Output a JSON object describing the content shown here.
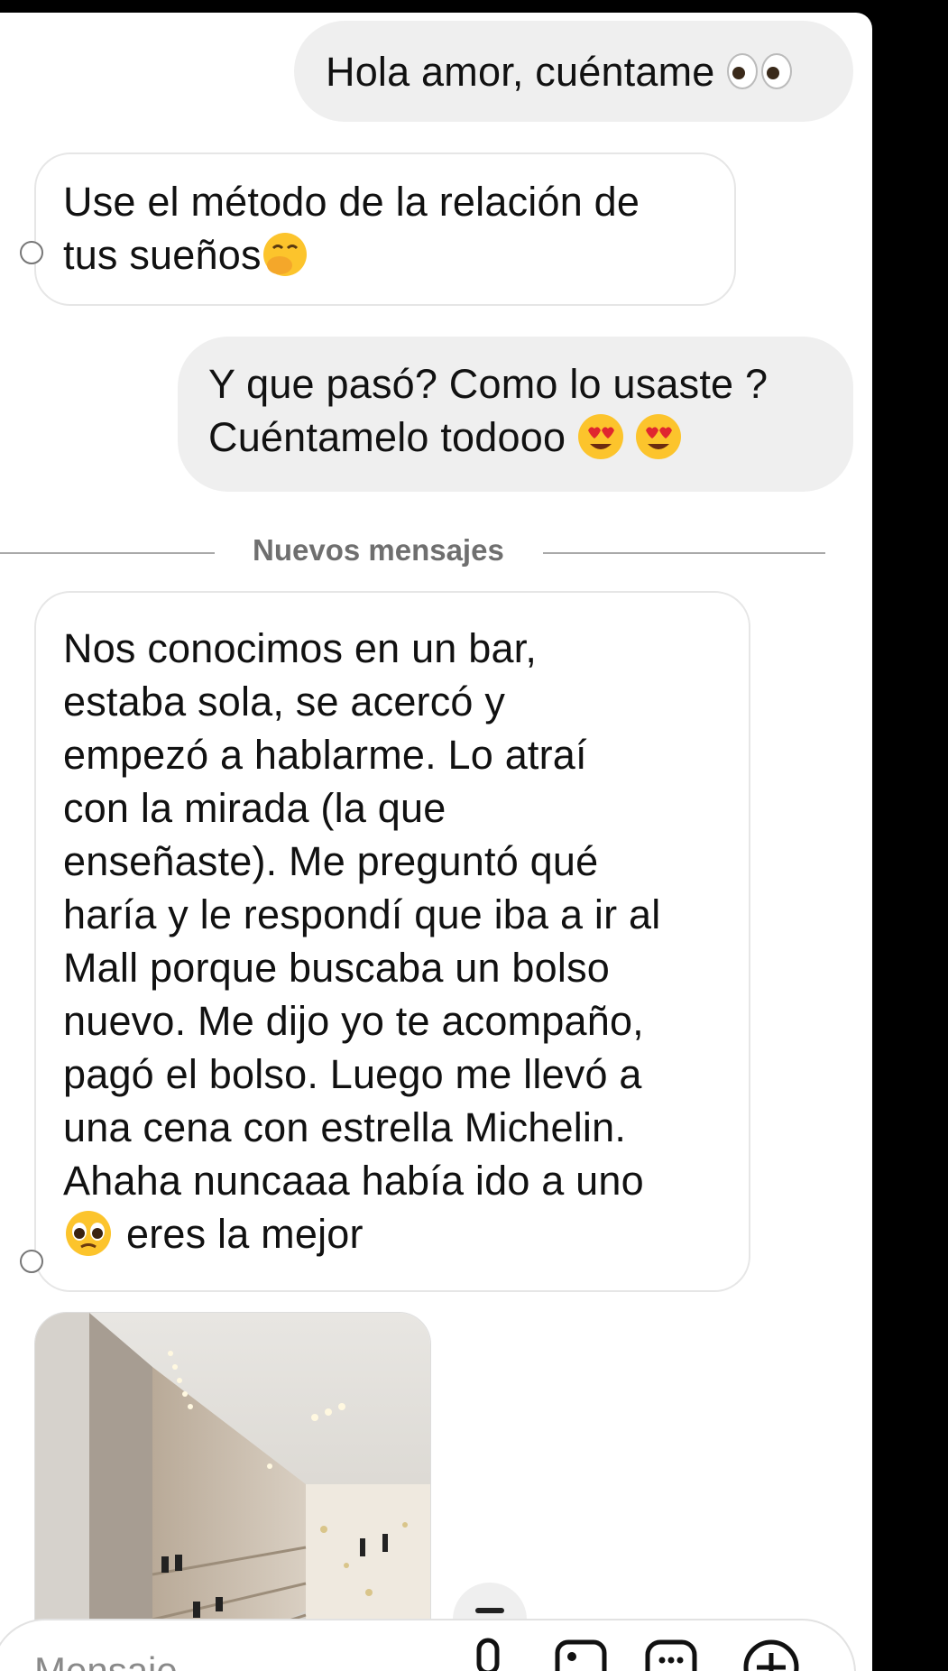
{
  "messages": [
    {
      "dir": "out",
      "text": "Hola amor, cuéntame",
      "emoji": "eyes-emoji"
    },
    {
      "dir": "in",
      "lines": [
        "Use el método de la relación de",
        "tus sueños"
      ],
      "emoji": "hand-over-mouth-emoji"
    },
    {
      "dir": "out",
      "lines": [
        "Y que pasó? Como lo usaste ?",
        "Cuéntamelo todooo"
      ],
      "emoji": "heart-eyes-emoji"
    },
    {
      "dir": "in",
      "lines": [
        "Nos conocimos en un bar,",
        "estaba sola, se acercó y",
        "empezó a hablarme. Lo atraí",
        "con la mirada (la que",
        "enseñaste). Me preguntó qué",
        "haría y le respondí que iba a ir al",
        "Mall porque buscaba un bolso",
        "nuevo. Me dijo yo te acompaño,",
        "pagó el bolso. Luego me llevó a",
        "una cena con estrella Michelin.",
        "Ahaha nuncaaa había ido a uno",
        "eres la mejor"
      ],
      "emoji": "pleading-face-emoji"
    }
  ],
  "divider": {
    "label": "Nuevos mensajes"
  },
  "composer": {
    "placeholder": "Mensaje"
  },
  "icons": [
    "eyes-emoji",
    "hand-over-mouth-emoji",
    "heart-eyes-emoji",
    "pleading-face-emoji",
    "microphone-icon",
    "gallery-icon",
    "sticker-icon",
    "plus-icon"
  ]
}
